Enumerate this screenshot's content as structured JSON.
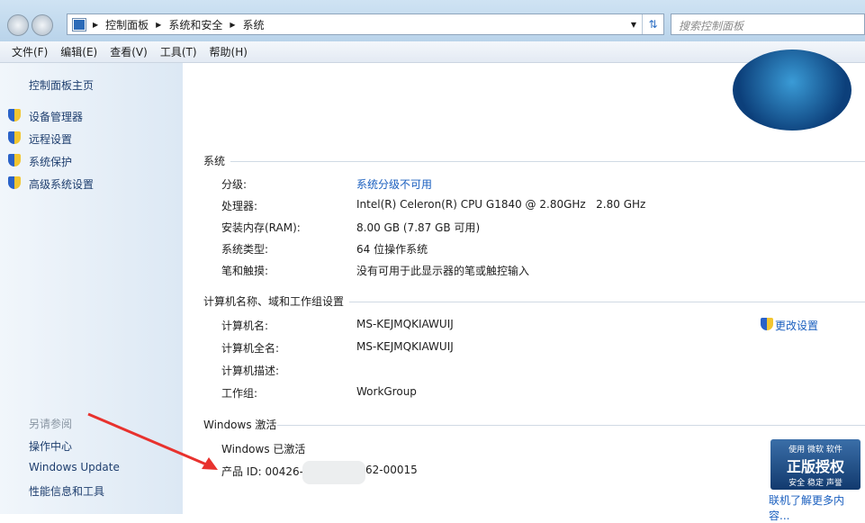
{
  "address": {
    "crumbs": [
      "控制面板",
      "系统和安全",
      "系统"
    ],
    "search_placeholder": "搜索控制面板"
  },
  "menu": [
    "文件(F)",
    "编辑(E)",
    "查看(V)",
    "工具(T)",
    "帮助(H)"
  ],
  "sidebar": {
    "home": "控制面板主页",
    "tasks": [
      "设备管理器",
      "远程设置",
      "系统保护",
      "高级系统设置"
    ],
    "see_also_title": "另请参阅",
    "see_also": [
      "操作中心",
      "Windows Update",
      "性能信息和工具"
    ]
  },
  "system": {
    "title": "系统",
    "rows": [
      [
        "分级:",
        "系统分级不可用"
      ],
      [
        "处理器:",
        "Intel(R) Celeron(R) CPU G1840 @ 2.80GHz   2.80 GHz"
      ],
      [
        "安装内存(RAM):",
        "8.00 GB (7.87 GB 可用)"
      ],
      [
        "系统类型:",
        "64 位操作系统"
      ],
      [
        "笔和触摸:",
        "没有可用于此显示器的笔或触控输入"
      ]
    ]
  },
  "computer": {
    "title": "计算机名称、域和工作组设置",
    "change": "更改设置",
    "rows": [
      [
        "计算机名:",
        "MS-KEJMQKIAWUIJ"
      ],
      [
        "计算机全名:",
        "MS-KEJMQKIAWUIJ"
      ],
      [
        "计算机描述:",
        ""
      ],
      [
        "工作组:",
        "WorkGroup"
      ]
    ]
  },
  "activation": {
    "title": "Windows 激活",
    "status": "Windows 已激活",
    "product_id_label": "产品 ID: 00426-",
    "product_id_tail": "62-00015",
    "badge": [
      "使用 微软 软件",
      "正版授权",
      "安全 稳定 声誉"
    ],
    "more": "联机了解更多内容..."
  }
}
